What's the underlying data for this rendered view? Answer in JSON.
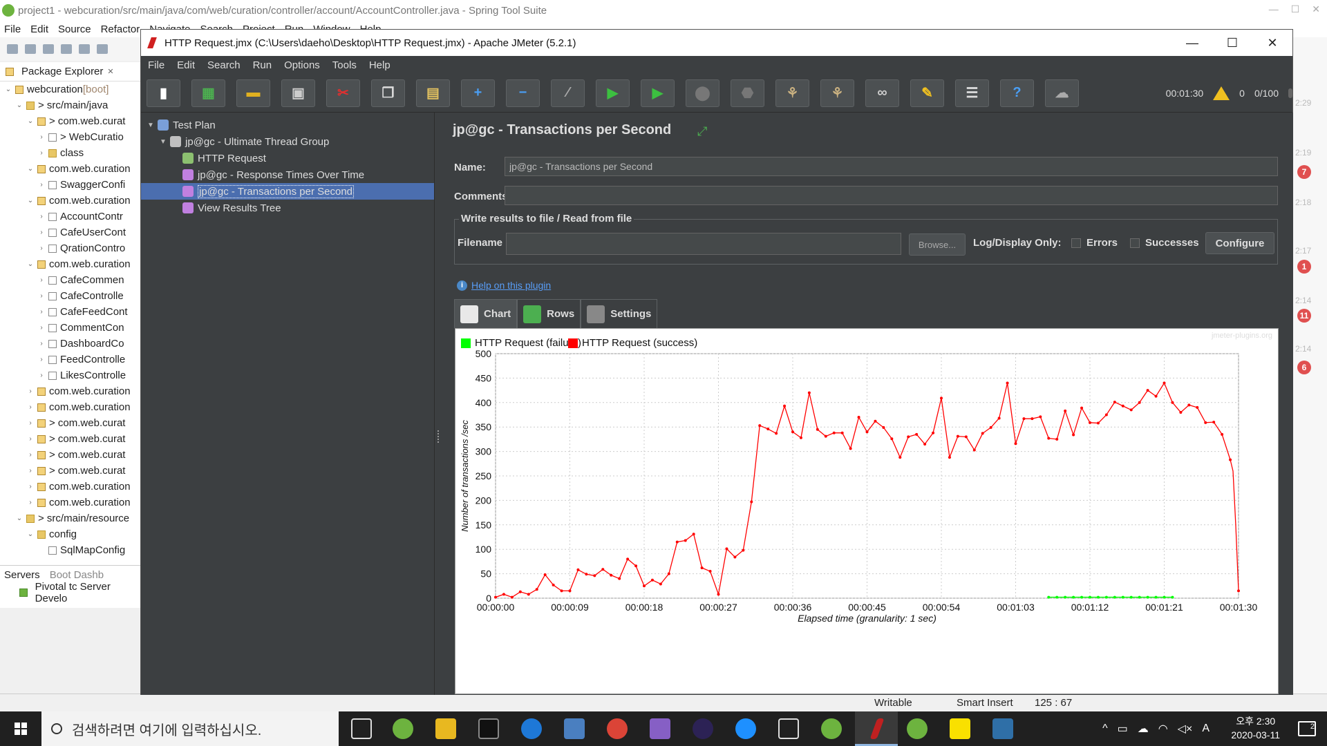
{
  "eclipse": {
    "window_title": "project1 - webcuration/src/main/java/com/web/curation/controller/account/AccountController.java - Spring Tool Suite",
    "menu": [
      "File",
      "Edit",
      "Source",
      "Refactor",
      "Navigate",
      "Search",
      "Project",
      "Run",
      "Window",
      "Help"
    ],
    "package_explorer": {
      "title": "Package Explorer",
      "rows": [
        {
          "indent": 0,
          "tw": "v",
          "icon": "project",
          "label": "webcuration",
          "suffix": " [boot]"
        },
        {
          "indent": 1,
          "tw": "v",
          "icon": "folder",
          "label": "> src/main/java",
          "suffix": ""
        },
        {
          "indent": 2,
          "tw": "v",
          "icon": "pkg",
          "label": "> com.web.curat",
          "suffix": ""
        },
        {
          "indent": 3,
          "tw": ">",
          "icon": "file",
          "label": "> WebCuratio",
          "suffix": ""
        },
        {
          "indent": 3,
          "tw": ">",
          "icon": "folder",
          "label": "class",
          "suffix": ""
        },
        {
          "indent": 2,
          "tw": "v",
          "icon": "pkg",
          "label": "com.web.curation",
          "suffix": ""
        },
        {
          "indent": 3,
          "tw": ">",
          "icon": "file",
          "label": "SwaggerConfi",
          "suffix": ""
        },
        {
          "indent": 2,
          "tw": "v",
          "icon": "pkg",
          "label": "com.web.curation",
          "suffix": ""
        },
        {
          "indent": 3,
          "tw": ">",
          "icon": "file",
          "label": "AccountContr",
          "suffix": ""
        },
        {
          "indent": 3,
          "tw": ">",
          "icon": "file",
          "label": "CafeUserCont",
          "suffix": ""
        },
        {
          "indent": 3,
          "tw": ">",
          "icon": "file",
          "label": "QrationContro",
          "suffix": ""
        },
        {
          "indent": 2,
          "tw": "v",
          "icon": "pkg",
          "label": "com.web.curation",
          "suffix": ""
        },
        {
          "indent": 3,
          "tw": ">",
          "icon": "file",
          "label": "CafeCommen",
          "suffix": ""
        },
        {
          "indent": 3,
          "tw": ">",
          "icon": "file",
          "label": "CafeControlle",
          "suffix": ""
        },
        {
          "indent": 3,
          "tw": ">",
          "icon": "file",
          "label": "CafeFeedCont",
          "suffix": ""
        },
        {
          "indent": 3,
          "tw": ">",
          "icon": "file",
          "label": "CommentCon",
          "suffix": ""
        },
        {
          "indent": 3,
          "tw": ">",
          "icon": "file",
          "label": "DashboardCo",
          "suffix": ""
        },
        {
          "indent": 3,
          "tw": ">",
          "icon": "file",
          "label": "FeedControlle",
          "suffix": ""
        },
        {
          "indent": 3,
          "tw": ">",
          "icon": "file",
          "label": "LikesControlle",
          "suffix": ""
        },
        {
          "indent": 2,
          "tw": ">",
          "icon": "pkg",
          "label": "com.web.curation",
          "suffix": ""
        },
        {
          "indent": 2,
          "tw": ">",
          "icon": "pkg",
          "label": "com.web.curation",
          "suffix": ""
        },
        {
          "indent": 2,
          "tw": ">",
          "icon": "pkg",
          "label": "> com.web.curat",
          "suffix": ""
        },
        {
          "indent": 2,
          "tw": ">",
          "icon": "pkg",
          "label": "> com.web.curat",
          "suffix": ""
        },
        {
          "indent": 2,
          "tw": ">",
          "icon": "pkg",
          "label": "> com.web.curat",
          "suffix": ""
        },
        {
          "indent": 2,
          "tw": ">",
          "icon": "pkg",
          "label": "> com.web.curat",
          "suffix": ""
        },
        {
          "indent": 2,
          "tw": ">",
          "icon": "pkg",
          "label": "com.web.curation",
          "suffix": ""
        },
        {
          "indent": 2,
          "tw": ">",
          "icon": "pkg",
          "label": "com.web.curation",
          "suffix": ""
        },
        {
          "indent": 1,
          "tw": "v",
          "icon": "folder",
          "label": "> src/main/resource",
          "suffix": ""
        },
        {
          "indent": 2,
          "tw": "v",
          "icon": "folder",
          "label": "config",
          "suffix": ""
        },
        {
          "indent": 3,
          "tw": "",
          "icon": "file",
          "label": "SqlMapConfig",
          "suffix": ""
        }
      ]
    },
    "servers_tab": "Servers",
    "boot_tab": "Boot Dashb",
    "server_row": "Pivotal tc Server Develo",
    "right_times": [
      "2:29",
      "2:19",
      "2:18",
      "2:17",
      "2:14",
      "2:14"
    ],
    "right_badges": [
      "7",
      "1",
      "11",
      "6"
    ],
    "status": {
      "writable": "Writable",
      "insert": "Smart Insert",
      "position": "125 : 67"
    }
  },
  "jmeter": {
    "window_title": "HTTP Request.jmx (C:\\Users\\daeho\\Desktop\\HTTP Request.jmx) - Apache JMeter (5.2.1)",
    "menu": [
      "File",
      "Edit",
      "Search",
      "Run",
      "Options",
      "Tools",
      "Help"
    ],
    "toolbar": {
      "elapsed": "00:01:30",
      "warnings": "0",
      "threads": "0/100"
    },
    "tree": [
      {
        "indent": 0,
        "tw": "▼",
        "icon": "test-plan",
        "label": "Test Plan",
        "selected": false
      },
      {
        "indent": 1,
        "tw": "▼",
        "icon": "thread-group",
        "label": "jp@gc - Ultimate Thread Group",
        "selected": false
      },
      {
        "indent": 2,
        "tw": "",
        "icon": "sampler",
        "label": "HTTP Request",
        "selected": false
      },
      {
        "indent": 2,
        "tw": "",
        "icon": "listener",
        "label": "jp@gc - Response Times Over Time",
        "selected": false
      },
      {
        "indent": 2,
        "tw": "",
        "icon": "listener",
        "label": "jp@gc - Transactions per Second",
        "selected": true
      },
      {
        "indent": 2,
        "tw": "",
        "icon": "listener",
        "label": "View Results Tree",
        "selected": false
      }
    ],
    "panel": {
      "title": "jp@gc - Transactions per Second",
      "name_label": "Name:",
      "name_value": "jp@gc - Transactions per Second",
      "comments_label": "Comments:",
      "comments_value": "",
      "file_group_title": "Write results to file / Read from file",
      "filename_label": "Filename",
      "filename_value": "",
      "browse_label": "Browse...",
      "log_display_label": "Log/Display Only:",
      "errors_label": "Errors",
      "successes_label": "Successes",
      "configure_label": "Configure",
      "help_link": "Help on this plugin",
      "tabs": [
        {
          "label": "Chart",
          "active": true
        },
        {
          "label": "Rows",
          "active": false
        },
        {
          "label": "Settings",
          "active": false
        }
      ]
    }
  },
  "chart_data": {
    "type": "line",
    "title": "",
    "xlabel": "Elapsed time (granularity: 1 sec)",
    "ylabel": "Number of transactions /sec",
    "watermark": "jmeter-plugins.org",
    "ylim": [
      0,
      500
    ],
    "xlim_seconds": [
      0,
      90
    ],
    "y_ticks": [
      "0",
      "50",
      "100",
      "150",
      "200",
      "250",
      "300",
      "350",
      "400",
      "450",
      "500"
    ],
    "x_ticks": [
      "00:00:00",
      "00:00:09",
      "00:00:18",
      "00:00:27",
      "00:00:36",
      "00:00:45",
      "00:00:54",
      "00:01:03",
      "00:01:12",
      "00:01:21",
      "00:01:30"
    ],
    "grid": true,
    "legend_position": "top-left",
    "series": [
      {
        "name": "HTTP Request (failure)",
        "color": "#00ff00",
        "x": [
          67,
          68,
          69,
          70,
          71,
          72,
          73,
          74,
          75,
          76,
          77,
          78,
          79,
          80,
          81,
          82
        ],
        "y": [
          2,
          2,
          2,
          2,
          2,
          2,
          2,
          2,
          2,
          2,
          2,
          2,
          2,
          2,
          2,
          2
        ]
      },
      {
        "name": "HTTP Request (success)",
        "color": "#ff0000",
        "x": [
          0,
          1,
          2,
          3,
          4,
          5,
          6,
          7,
          8,
          9,
          10,
          11,
          12,
          13,
          14,
          15,
          16,
          17,
          18,
          19,
          20,
          21,
          22,
          23,
          24,
          25,
          26,
          27,
          28,
          29,
          30,
          31,
          32,
          33,
          34,
          35,
          36,
          37,
          38,
          39,
          40,
          41,
          42,
          43,
          44,
          45,
          46,
          47,
          48,
          49,
          50,
          51,
          52,
          53,
          54,
          55,
          56,
          57,
          58,
          59,
          60,
          61,
          62,
          63,
          64,
          65,
          66,
          67,
          68,
          69,
          70,
          71,
          72,
          73,
          74,
          75,
          76,
          77,
          78,
          79,
          80,
          81,
          82,
          83,
          84,
          85,
          86,
          87,
          88,
          89
        ],
        "y": [
          2,
          8,
          2,
          13,
          8,
          18,
          48,
          27,
          15,
          15,
          58,
          49,
          46,
          59,
          47,
          40,
          80,
          66,
          25,
          37,
          29,
          50,
          115,
          118,
          131,
          62,
          55,
          8,
          101,
          84,
          98,
          197,
          353,
          346,
          337,
          393,
          340,
          328,
          420,
          345,
          331,
          338,
          338,
          306,
          370,
          340,
          362,
          349,
          326,
          288,
          330,
          335,
          315,
          338,
          409,
          288,
          331,
          330,
          303,
          337,
          349,
          368,
          440,
          316,
          367,
          367,
          371,
          327,
          325,
          383,
          334,
          389,
          359,
          358,
          375,
          401,
          393,
          385,
          400,
          425,
          413,
          440,
          400,
          380,
          395,
          390,
          359,
          360,
          335,
          283
        ],
        "note_tail": "after 89s the series descends: 90s≈15"
      }
    ]
  }
}
